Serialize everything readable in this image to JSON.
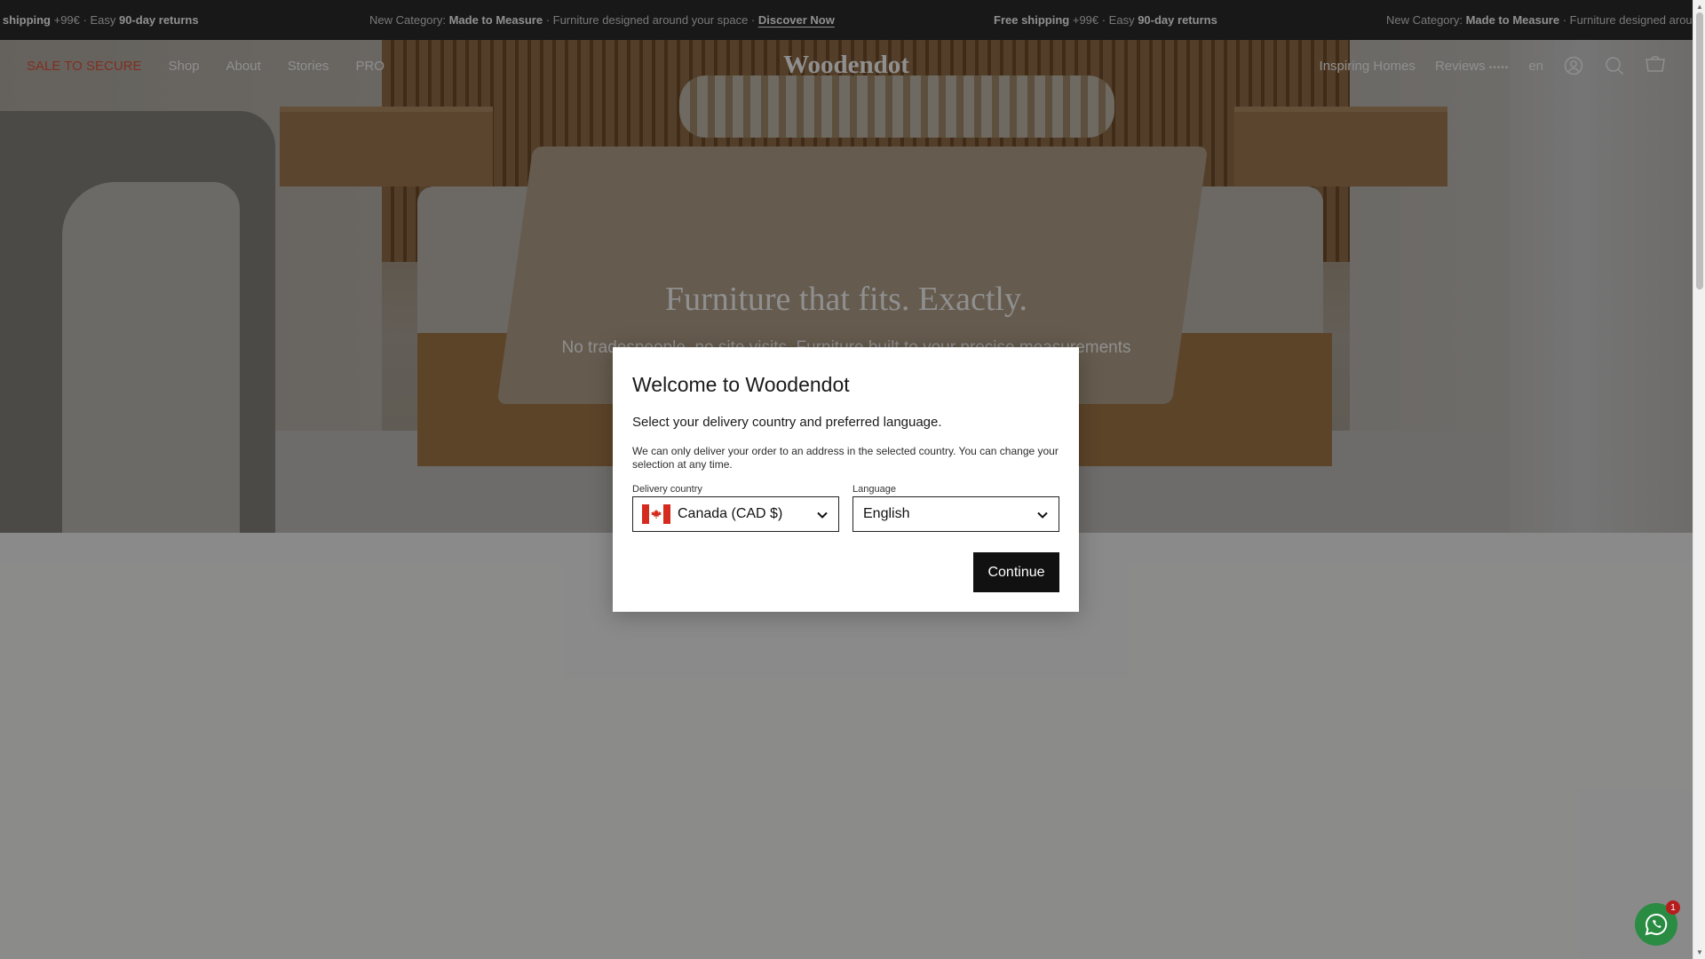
{
  "announcement": {
    "items": [
      {
        "pre": "e shipping",
        "mid": " +99€ · Easy ",
        "bold": "90-day returns"
      },
      {
        "pre": "New Category: ",
        "bold": "Made to Measure",
        "mid": " · Furniture designed around your space · ",
        "link": "Discover Now"
      },
      {
        "bold1": "Free shipping",
        "mid": " +99€ · Easy ",
        "bold": "90-day returns"
      },
      {
        "pre": "New Category: ",
        "bold": "Made to Measure",
        "mid": " · Furniture designed arour"
      }
    ]
  },
  "header": {
    "promo": "SALE TO SECURE",
    "nav": [
      "Shop",
      "About",
      "Stories",
      "PRO"
    ],
    "logo": "Woodendot",
    "right": {
      "inspiring": "Inspiring Homes",
      "reviews": "Reviews",
      "stars": "•••••",
      "lang": "en"
    },
    "icons": [
      "account-icon",
      "search-icon",
      "cart-icon"
    ]
  },
  "hero": {
    "title": "Furniture that fits. Exactly.",
    "subtitle": "No tradespeople, no site visits. Furniture built to your precise measurements"
  },
  "modal": {
    "title": "Welcome to Woodendot",
    "subtitle": "Select your delivery country and preferred language.",
    "note": "We can only deliver your order to an address in the selected country. You can change your selection at any time.",
    "country_label": "Delivery country",
    "country_value": "Canada (CAD $)",
    "language_label": "Language",
    "language_value": "English",
    "continue": "Continue"
  },
  "whatsapp": {
    "badge": "1"
  },
  "colors": {
    "promo": "#e2543c",
    "whatsapp": "#2a8c43",
    "badge": "#b81d1d"
  }
}
